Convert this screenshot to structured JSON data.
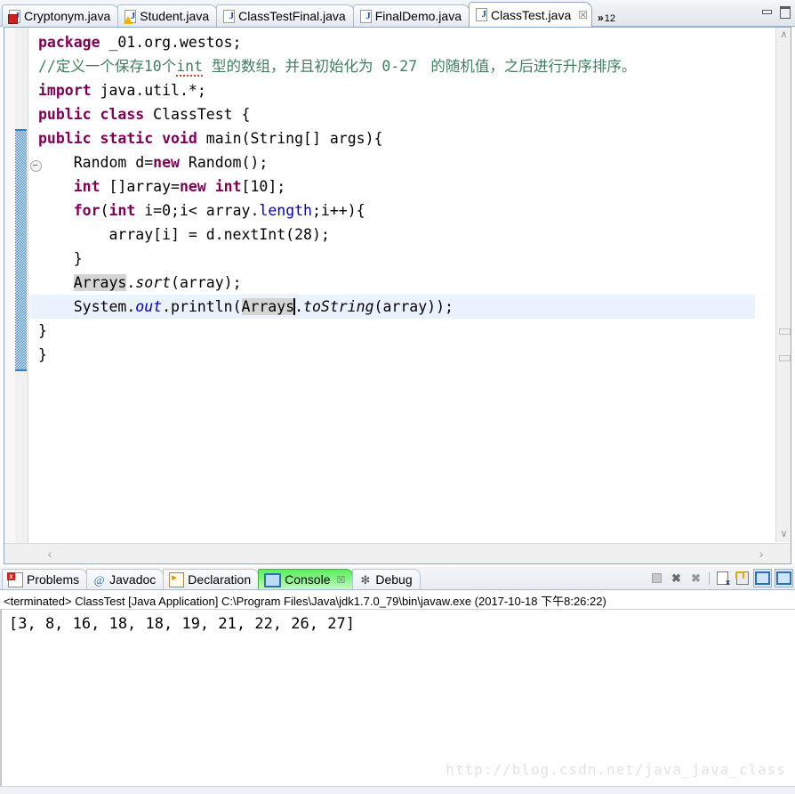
{
  "editor": {
    "tabs": [
      {
        "label": "Cryptonym.java",
        "icon": "java-file-error-icon",
        "badge": "err",
        "active": false
      },
      {
        "label": "Student.java",
        "icon": "java-file-warning-icon",
        "badge": "warn",
        "active": false
      },
      {
        "label": "ClassTestFinal.java",
        "icon": "java-file-icon",
        "badge": "",
        "active": false
      },
      {
        "label": "FinalDemo.java",
        "icon": "java-file-icon",
        "badge": "",
        "active": false
      },
      {
        "label": "ClassTest.java",
        "icon": "java-file-icon",
        "badge": "",
        "active": true
      }
    ],
    "more_tabs_chevron": "»",
    "more_tabs_count": "12",
    "close_glyph": "☒",
    "scroll_left_glyph": "‹",
    "scroll_right_glyph": "›",
    "scroll_up_glyph": "∧",
    "scroll_down_glyph": "∨",
    "code_lines": [
      {
        "n": 1,
        "segments": [
          {
            "t": "package",
            "c": "kw"
          },
          {
            "t": " _01.org.westos;",
            "c": "plain"
          }
        ]
      },
      {
        "n": 2,
        "segments": [
          {
            "t": "//",
            "c": "cmt"
          },
          {
            "t": "定义一个保存",
            "c": "cmt-zh"
          },
          {
            "t": "10",
            "c": "cmt"
          },
          {
            "t": "个",
            "c": "cmt-zh"
          },
          {
            "t": "int",
            "c": "cmt-squig"
          },
          {
            "t": " ",
            "c": "cmt"
          },
          {
            "t": "型的数组，并且初始化为",
            "c": "cmt-zh"
          },
          {
            "t": " 0-27 ",
            "c": "cmt"
          },
          {
            "t": " 的随机值，之后进行升序排序。",
            "c": "cmt-zh"
          }
        ]
      },
      {
        "n": 3,
        "segments": [
          {
            "t": "import",
            "c": "kw"
          },
          {
            "t": " java.util.*;",
            "c": "plain"
          }
        ]
      },
      {
        "n": 4,
        "segments": [
          {
            "t": "public",
            "c": "kw"
          },
          {
            "t": " ",
            "c": "plain"
          },
          {
            "t": "class",
            "c": "kw"
          },
          {
            "t": " ClassTest {",
            "c": "plain"
          }
        ]
      },
      {
        "n": 5,
        "segments": [
          {
            "t": "public",
            "c": "kw"
          },
          {
            "t": " ",
            "c": "plain"
          },
          {
            "t": "static",
            "c": "kw"
          },
          {
            "t": " ",
            "c": "plain"
          },
          {
            "t": "void",
            "c": "kw"
          },
          {
            "t": " main(String[] args){",
            "c": "plain"
          }
        ]
      },
      {
        "n": 6,
        "segments": [
          {
            "t": "    Random d=",
            "c": "plain"
          },
          {
            "t": "new",
            "c": "kw"
          },
          {
            "t": " Random();",
            "c": "plain"
          }
        ]
      },
      {
        "n": 7,
        "segments": [
          {
            "t": "    ",
            "c": "plain"
          },
          {
            "t": "int",
            "c": "kw"
          },
          {
            "t": " []array=",
            "c": "plain"
          },
          {
            "t": "new",
            "c": "kw"
          },
          {
            "t": " ",
            "c": "plain"
          },
          {
            "t": "int",
            "c": "kw"
          },
          {
            "t": "[10];",
            "c": "plain"
          }
        ]
      },
      {
        "n": 8,
        "segments": [
          {
            "t": "    ",
            "c": "plain"
          },
          {
            "t": "for",
            "c": "kw"
          },
          {
            "t": "(",
            "c": "plain"
          },
          {
            "t": "int",
            "c": "kw"
          },
          {
            "t": " i=0;i< array.",
            "c": "plain"
          },
          {
            "t": "length",
            "c": "fld"
          },
          {
            "t": ";i++){",
            "c": "plain"
          }
        ]
      },
      {
        "n": 9,
        "segments": [
          {
            "t": "        array[i] = d.nextInt(28);",
            "c": "plain"
          }
        ]
      },
      {
        "n": 10,
        "segments": [
          {
            "t": "    }",
            "c": "plain"
          }
        ]
      },
      {
        "n": 11,
        "segments": [
          {
            "t": "    ",
            "c": "plain"
          },
          {
            "t": "Arrays",
            "c": "occ"
          },
          {
            "t": ".",
            "c": "plain"
          },
          {
            "t": "sort",
            "c": "sm"
          },
          {
            "t": "(array);",
            "c": "plain"
          }
        ]
      },
      {
        "n": 12,
        "current": true,
        "segments": [
          {
            "t": "    System.",
            "c": "plain"
          },
          {
            "t": "out",
            "c": "fld-i"
          },
          {
            "t": ".println(",
            "c": "plain"
          },
          {
            "t": "Arrays",
            "c": "occ"
          },
          {
            "t": "|caret|",
            "c": "caret"
          },
          {
            "t": ".",
            "c": "plain"
          },
          {
            "t": "toString",
            "c": "sm"
          },
          {
            "t": "(array));",
            "c": "plain"
          }
        ]
      },
      {
        "n": 13,
        "segments": [
          {
            "t": "}",
            "c": "plain"
          }
        ]
      },
      {
        "n": 14,
        "segments": [
          {
            "t": "}",
            "c": "plain"
          }
        ]
      }
    ]
  },
  "console_panel": {
    "tabs": [
      {
        "label": "Problems",
        "icon": "problems-icon",
        "active": false,
        "closable": false
      },
      {
        "label": "Javadoc",
        "icon": "javadoc-icon",
        "active": false,
        "closable": false
      },
      {
        "label": "Declaration",
        "icon": "declaration-icon",
        "active": false,
        "closable": false
      },
      {
        "label": "Console",
        "icon": "console-icon",
        "active": true,
        "closable": true
      },
      {
        "label": "Debug",
        "icon": "debug-icon",
        "active": false,
        "closable": false
      }
    ],
    "javadoc_glyph": "@",
    "debug_glyph": "✻",
    "close_glyph": "☒",
    "toolbar": [
      {
        "name": "terminate-button",
        "glyph": ""
      },
      {
        "name": "remove-launch-button",
        "glyph": "✖"
      },
      {
        "name": "remove-all-terminated-button",
        "glyph": "✖"
      },
      {
        "name": "clear-console-button",
        "glyph": ""
      },
      {
        "name": "scroll-lock-button",
        "glyph": ""
      },
      {
        "name": "display-selected-console-button",
        "glyph": ""
      },
      {
        "name": "open-console-button",
        "glyph": ""
      }
    ],
    "launch_header": "<terminated> ClassTest [Java Application] C:\\Program Files\\Java\\jdk1.7.0_79\\bin\\javaw.exe (2017-10-18 下午8:26:22)",
    "output": "[3, 8, 16, 18, 18, 19, 21, 22, 26, 27]",
    "watermark": "http://blog.csdn.net/java_java_class"
  },
  "colors": {
    "keyword": "#7F0055",
    "comment": "#3F7F5F",
    "field": "#0000C0",
    "occurrence_highlight": "#D4D4D4",
    "current_line": "#EAF2FD",
    "active_console_tab": "#5DF05D",
    "change_bar": "#2B7FD6"
  }
}
